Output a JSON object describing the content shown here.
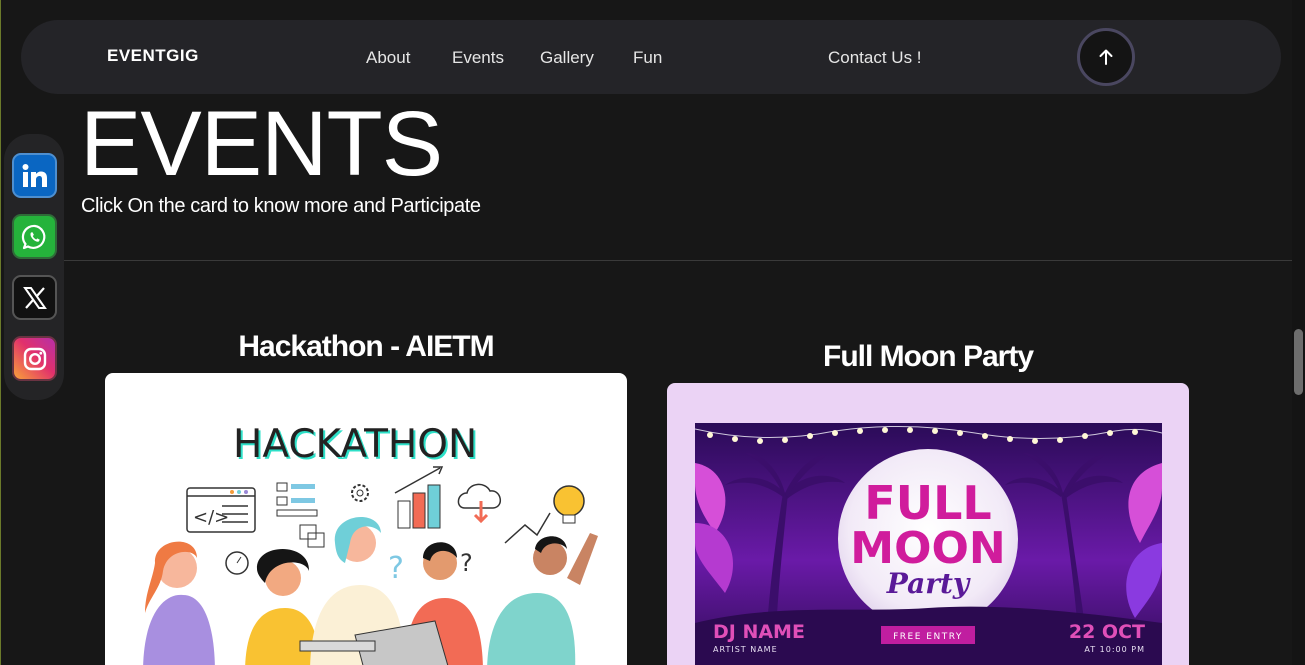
{
  "nav": {
    "logo": "EVENTGIG",
    "links": [
      "About",
      "Events",
      "Gallery",
      "Fun"
    ],
    "contact": "Contact Us !",
    "up_icon": "arrow-up-icon"
  },
  "socials": [
    "linkedin-icon",
    "whatsapp-icon",
    "x-icon",
    "instagram-icon"
  ],
  "hero": {
    "title": "EVENTS",
    "subtitle": "Click On the card to know more and Participate"
  },
  "cards": [
    {
      "title": "Hackathon - AIETM",
      "image_text": "HACKATHON"
    },
    {
      "title": "Full Moon Party",
      "poster": {
        "line1": "FULL",
        "line2": "MOON",
        "line3": "Party",
        "dj": "DJ NAME",
        "artist": "ARTIST NAME",
        "entry": "FREE ENTRY",
        "date": "22 OCT",
        "time": "AT 10:00 PM"
      }
    }
  ],
  "colors": {
    "background": "#171717",
    "navbar": "#242428",
    "linkedin": "#0a66c2",
    "whatsapp": "#25b33b",
    "poster_bg": "#ebd3f5",
    "poster_magenta": "#d01c9c"
  }
}
